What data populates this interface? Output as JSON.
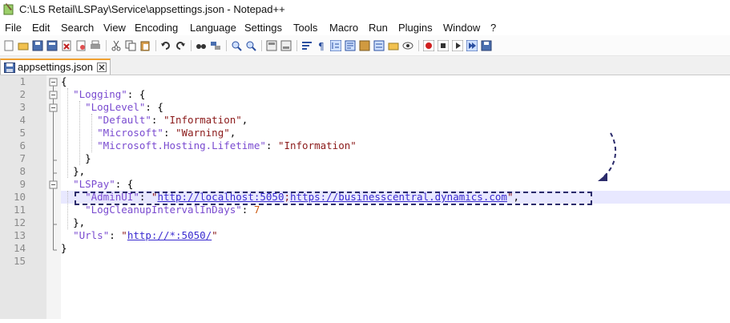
{
  "window": {
    "title": "C:\\LS Retail\\LSPay\\Service\\appsettings.json - Notepad++"
  },
  "menu": [
    "File",
    "Edit",
    "Search",
    "View",
    "Encoding",
    "Language",
    "Settings",
    "Tools",
    "Macro",
    "Run",
    "Plugins",
    "Window",
    "?"
  ],
  "toolbar": {
    "icons": [
      "new-file-icon",
      "open-file-icon",
      "save-icon",
      "save-all-icon",
      "close-icon",
      "close-all-icon",
      "print-icon",
      "cut-icon",
      "copy-icon",
      "paste-icon",
      "undo-icon",
      "redo-icon",
      "find-icon",
      "replace-icon",
      "zoom-in-icon",
      "zoom-out-icon",
      "sync-vertical-icon",
      "sync-horizontal-icon",
      "word-wrap-icon",
      "show-all-chars-icon",
      "indent-guide-icon",
      "language-udl-icon",
      "doc-map-icon",
      "function-list-icon",
      "folder-workspace-icon",
      "monitor-icon",
      "record-macro-icon",
      "stop-macro-icon",
      "play-macro-icon",
      "run-macro-icon",
      "save-macro-icon"
    ]
  },
  "tab": {
    "label": "appsettings.json"
  },
  "editor": {
    "line_numbers": [
      "1",
      "2",
      "3",
      "4",
      "5",
      "6",
      "7",
      "8",
      "9",
      "10",
      "11",
      "12",
      "13",
      "14",
      "15"
    ],
    "lines": [
      {
        "indent": "",
        "parts": [
          [
            "p",
            "{"
          ]
        ]
      },
      {
        "indent": "  ",
        "parts": [
          [
            "k",
            "\"Logging\""
          ],
          [
            "p",
            ": {"
          ]
        ]
      },
      {
        "indent": "    ",
        "parts": [
          [
            "k",
            "\"LogLevel\""
          ],
          [
            "p",
            ": {"
          ]
        ]
      },
      {
        "indent": "      ",
        "parts": [
          [
            "k",
            "\"Default\""
          ],
          [
            "p",
            ": "
          ],
          [
            "s",
            "\"Information\""
          ],
          [
            "p",
            ","
          ]
        ]
      },
      {
        "indent": "      ",
        "parts": [
          [
            "k",
            "\"Microsoft\""
          ],
          [
            "p",
            ": "
          ],
          [
            "s",
            "\"Warning\""
          ],
          [
            "p",
            ","
          ]
        ]
      },
      {
        "indent": "      ",
        "parts": [
          [
            "k",
            "\"Microsoft.Hosting.Lifetime\""
          ],
          [
            "p",
            ": "
          ],
          [
            "s",
            "\"Information\""
          ]
        ]
      },
      {
        "indent": "    ",
        "parts": [
          [
            "p",
            "}"
          ]
        ]
      },
      {
        "indent": "  ",
        "parts": [
          [
            "p",
            "},"
          ]
        ]
      },
      {
        "indent": "  ",
        "parts": [
          [
            "k",
            "\"LSPay\""
          ],
          [
            "p",
            ": {"
          ]
        ]
      },
      {
        "indent": "    ",
        "parts": [
          [
            "k",
            "\"AdminUI\""
          ],
          [
            "p",
            ": "
          ],
          [
            "s",
            "\""
          ],
          [
            "u",
            "http://localhost:5050"
          ],
          [
            "s",
            ";"
          ],
          [
            "u",
            "https://businesscentral.dynamics.com"
          ],
          [
            "s",
            "\""
          ],
          [
            "p",
            ","
          ]
        ]
      },
      {
        "indent": "    ",
        "parts": [
          [
            "k",
            "\"LogCleanupIntervalInDays\""
          ],
          [
            "p",
            ": "
          ],
          [
            "n",
            "7"
          ]
        ]
      },
      {
        "indent": "  ",
        "parts": [
          [
            "p",
            "},"
          ]
        ]
      },
      {
        "indent": "  ",
        "parts": [
          [
            "k",
            "\"Urls\""
          ],
          [
            "p",
            ": "
          ],
          [
            "s",
            "\""
          ],
          [
            "u",
            "http://*:5050/"
          ],
          [
            "s",
            "\""
          ]
        ]
      },
      {
        "indent": "",
        "parts": [
          [
            "p",
            "}"
          ]
        ]
      },
      {
        "indent": "",
        "parts": []
      }
    ]
  },
  "colors": {
    "tab_accent": "#f0a030",
    "annotation": "#2b2b6b",
    "key": "#7a4bd0",
    "string": "#8b1a1a",
    "number": "#cc5a10"
  }
}
